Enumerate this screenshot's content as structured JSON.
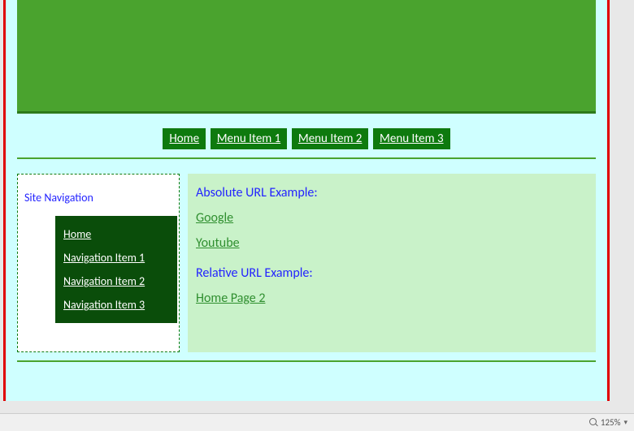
{
  "topnav": {
    "items": [
      {
        "label": "Home"
      },
      {
        "label": "Menu Item 1"
      },
      {
        "label": "Menu Item 2"
      },
      {
        "label": "Menu Item 3"
      }
    ]
  },
  "sidebar": {
    "title": "Site Navigation",
    "items": [
      {
        "label": "Home"
      },
      {
        "label": "Navigation Item 1"
      },
      {
        "label": "Navigation Item 2"
      },
      {
        "label": "Navigation Item 3"
      }
    ]
  },
  "content": {
    "heading1": "Absolute URL Example:",
    "link1": "Google",
    "link2": "Youtube",
    "heading2": "Relative URL Example:",
    "link3": "Home Page 2"
  },
  "statusbar": {
    "zoom": "125%"
  }
}
